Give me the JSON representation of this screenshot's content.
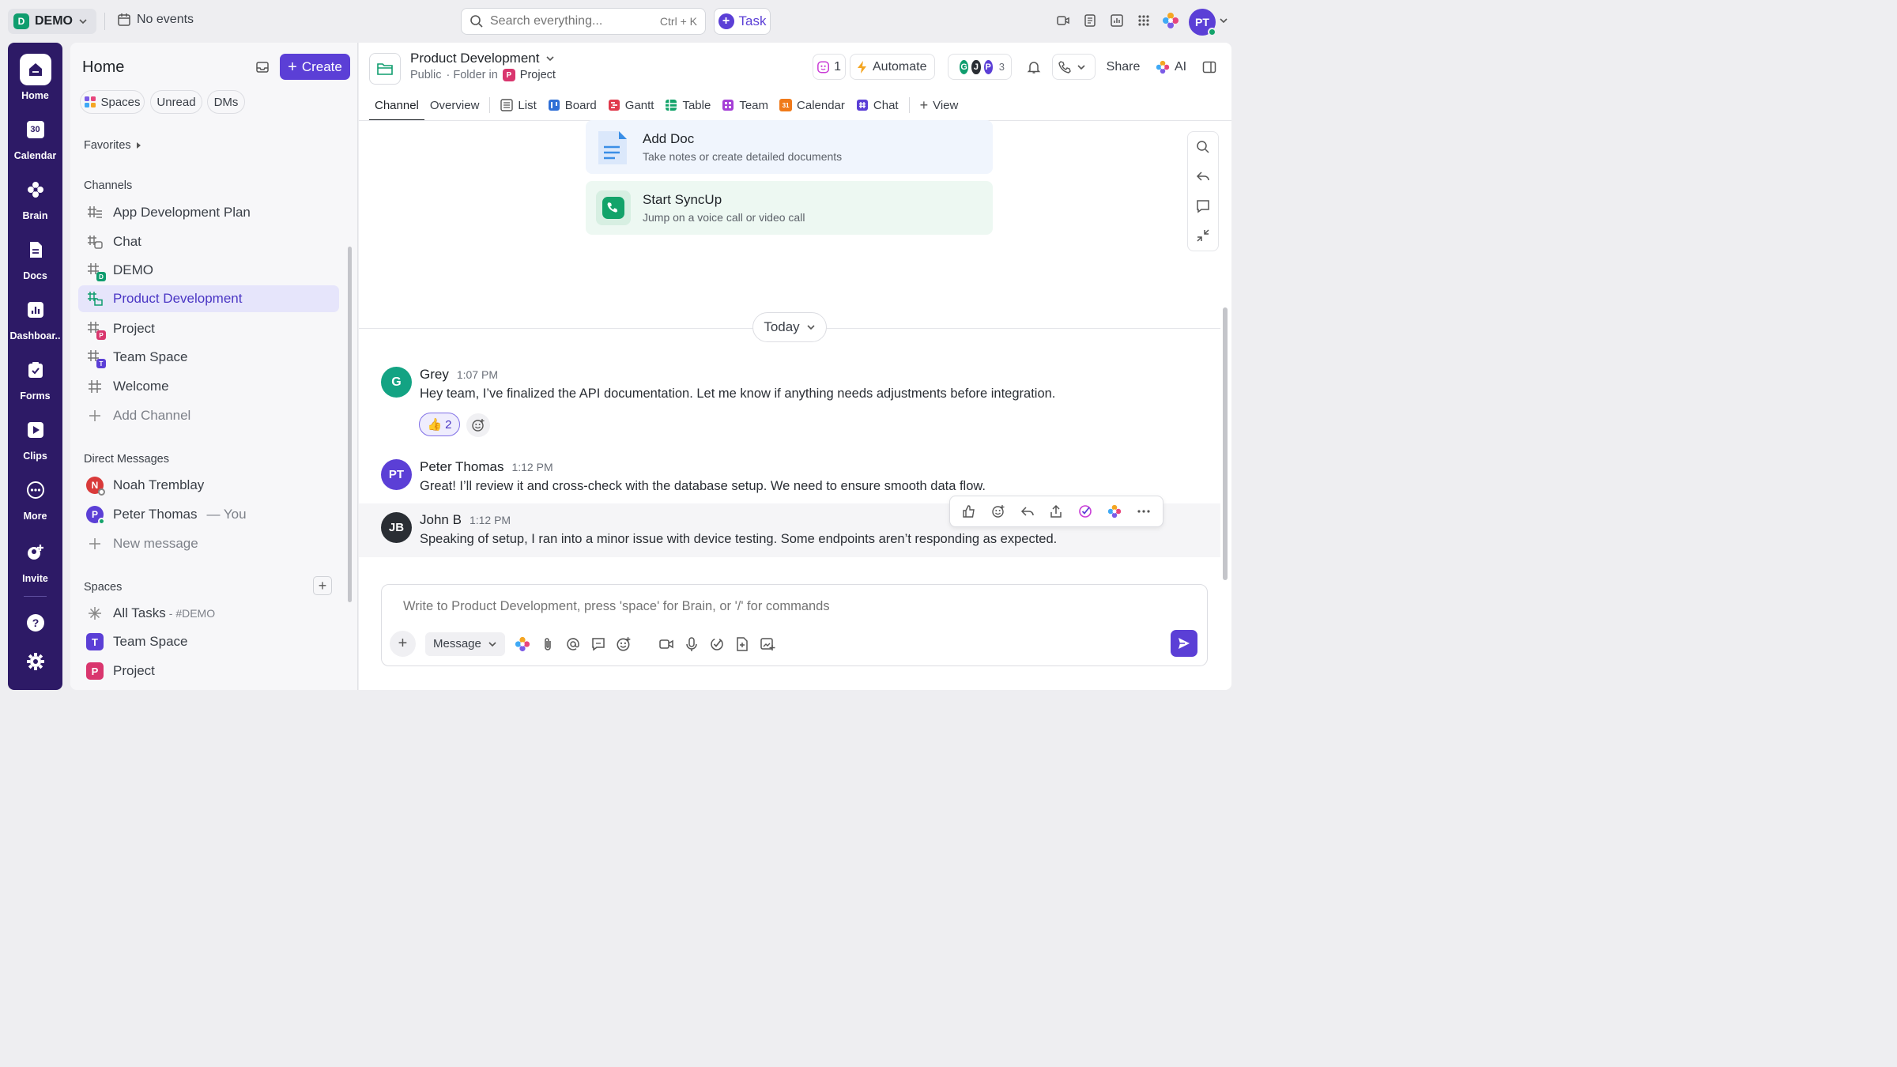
{
  "topbar": {
    "workspace_initial": "D",
    "workspace_name": "DEMO",
    "events": "No events",
    "search_placeholder": "Search everything...",
    "search_shortcut": "Ctrl + K",
    "task_label": "Task",
    "user_initials": "PT"
  },
  "rail": {
    "items": [
      {
        "label": "Home",
        "icon": "home-icon"
      },
      {
        "label": "Calendar",
        "icon": "calendar-icon"
      },
      {
        "label": "Brain",
        "icon": "brain-icon"
      },
      {
        "label": "Docs",
        "icon": "docs-icon"
      },
      {
        "label": "Dashboar..",
        "icon": "dashboard-icon"
      },
      {
        "label": "Forms",
        "icon": "forms-icon"
      },
      {
        "label": "Clips",
        "icon": "clips-icon"
      },
      {
        "label": "More",
        "icon": "more-icon"
      },
      {
        "label": "Invite",
        "icon": "invite-icon"
      }
    ],
    "calendar_day": "30"
  },
  "sidebar": {
    "title": "Home",
    "create_label": "Create",
    "pills": [
      "Spaces",
      "Unread",
      "DMs"
    ],
    "favorites_label": "Favorites",
    "channels_label": "Channels",
    "channels": [
      {
        "name": "App Development Plan",
        "badge": ""
      },
      {
        "name": "Chat",
        "badge": ""
      },
      {
        "name": "DEMO",
        "badge": "D"
      },
      {
        "name": "Product Development",
        "badge": ""
      },
      {
        "name": "Project",
        "badge": "P"
      },
      {
        "name": "Team Space",
        "badge": "T"
      },
      {
        "name": "Welcome",
        "badge": ""
      }
    ],
    "add_channel": "Add Channel",
    "dm_label": "Direct Messages",
    "dms": [
      {
        "initial": "N",
        "name": "Noah Tremblay",
        "suffix": ""
      },
      {
        "initial": "P",
        "name": "Peter Thomas",
        "suffix": "— You"
      }
    ],
    "new_message": "New message",
    "spaces_label": "Spaces",
    "spaces": [
      {
        "name": "All Tasks",
        "suffix": "- #DEMO",
        "initial": ""
      },
      {
        "name": "Team Space",
        "suffix": "",
        "initial": "T"
      },
      {
        "name": "Project",
        "suffix": "",
        "initial": "P"
      }
    ]
  },
  "header": {
    "title": "Product Development",
    "visibility": "Public",
    "folder_in": "· Folder in",
    "folder_badge": "P",
    "folder_name": "Project",
    "ai_count": "1",
    "automate": "Automate",
    "member_initials": [
      "G",
      "J",
      "P"
    ],
    "member_count": "3",
    "share": "Share",
    "ai": "AI"
  },
  "tabs": [
    "Channel",
    "Overview",
    "List",
    "Board",
    "Gantt",
    "Table",
    "Team",
    "Calendar",
    "Chat",
    "View"
  ],
  "tab_calendar_day": "31",
  "cards": [
    {
      "title": "Add Doc",
      "subtitle": "Take notes or create detailed documents"
    },
    {
      "title": "Start SyncUp",
      "subtitle": "Jump on a voice call or video call"
    }
  ],
  "today_label": "Today",
  "messages": [
    {
      "initials": "G",
      "name": "Grey",
      "time": "1:07 PM",
      "text": "Hey team, I’ve finalized the API documentation. Let me know if anything needs adjustments before integration."
    },
    {
      "initials": "PT",
      "name": "Peter Thomas",
      "time": "1:12 PM",
      "text": "Great! I’ll review it and cross-check with the database setup. We need to ensure smooth data flow."
    },
    {
      "initials": "JB",
      "name": "John B",
      "time": "1:12 PM",
      "text": "Speaking of setup, I ran into a minor issue with device testing. Some endpoints aren’t responding as expected."
    }
  ],
  "reaction": {
    "emoji": "👍",
    "count": "2"
  },
  "composer": {
    "placeholder": "Write to Product Development, press 'space' for Brain, or '/' for commands",
    "mode": "Message"
  },
  "colors": {
    "accent": "#5b3fd6",
    "rail": "#2d1a66",
    "green": "#0f9d6e",
    "pink": "#d9366e"
  }
}
